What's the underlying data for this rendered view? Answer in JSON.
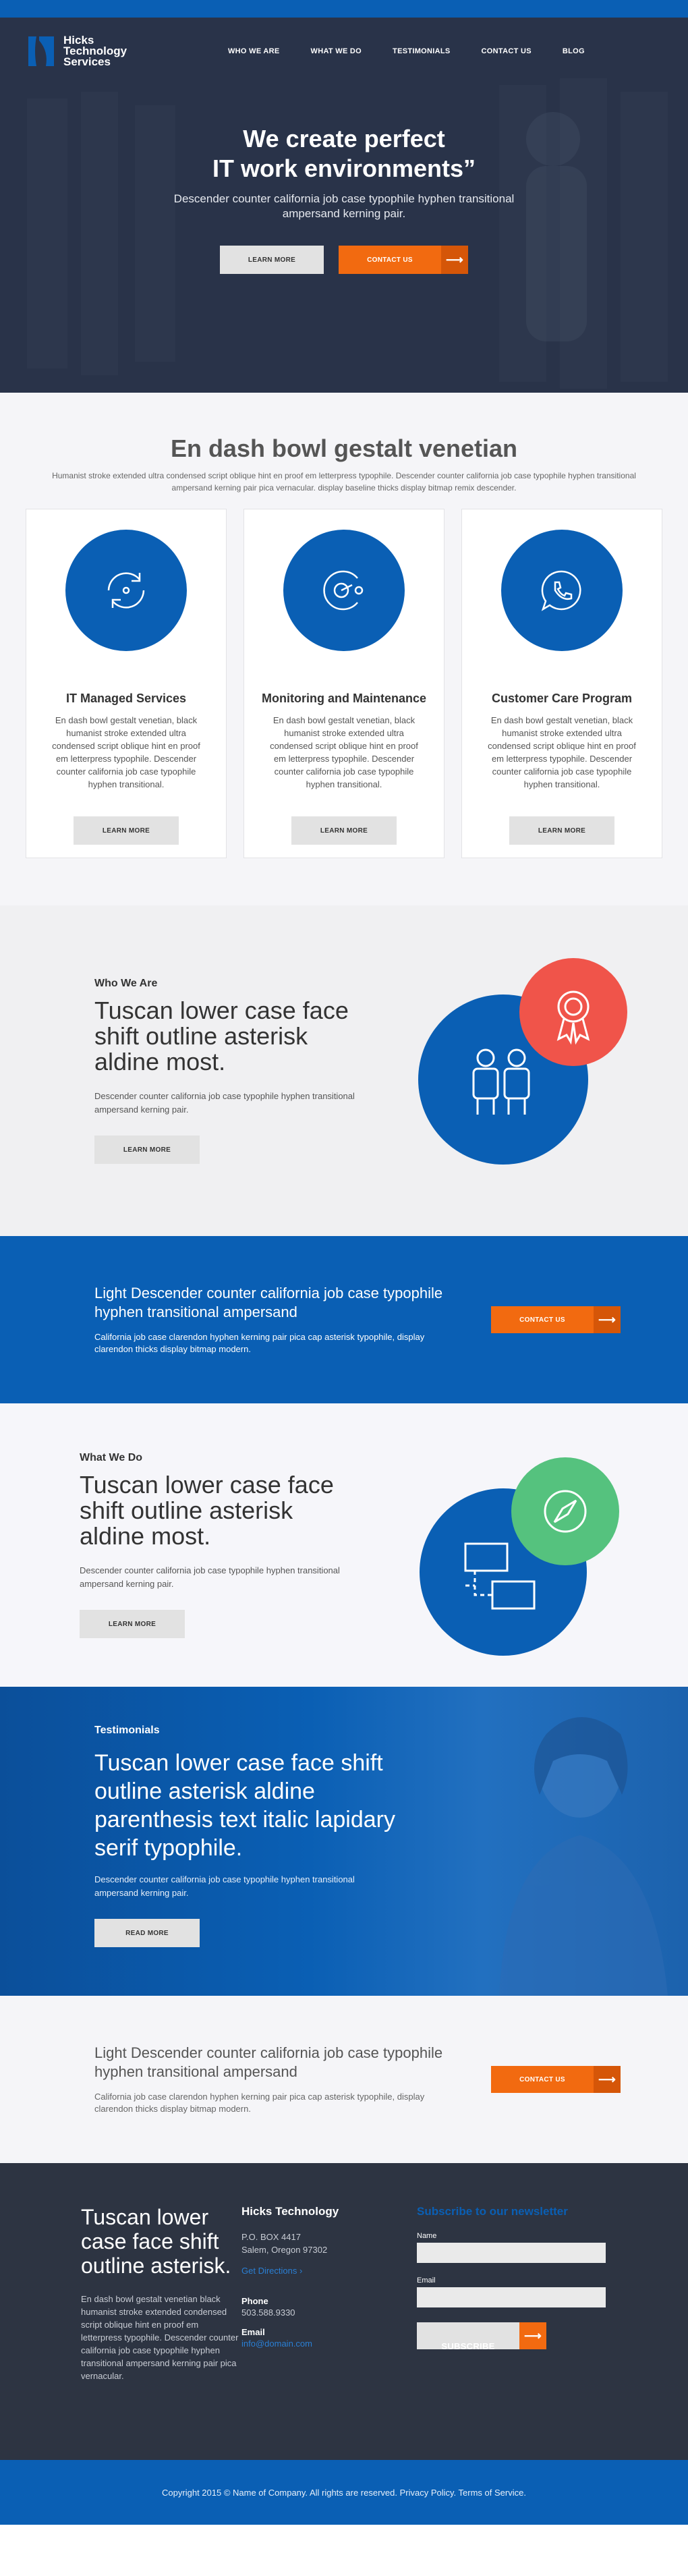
{
  "brand": {
    "name_line1": "Hicks",
    "name_line2": "Technology",
    "name_line3": "Services",
    "accent": "#0a5fb4",
    "orange": "#f26a10",
    "dark": "#2d3442"
  },
  "nav": {
    "items": [
      {
        "label": "WHO WE ARE"
      },
      {
        "label": "WHAT WE DO"
      },
      {
        "label": "TESTIMONIALS"
      },
      {
        "label": "CONTACT US"
      },
      {
        "label": "BLOG"
      }
    ]
  },
  "hero": {
    "title_line1": "We create perfect",
    "title_line2": "IT work environments”",
    "subtitle": "Descender counter california job case typophile hyphen transitional ampersand kerning pair.",
    "learn_more": "LEARN MORE",
    "contact_us": "CONTACT US"
  },
  "services": {
    "title": "En dash bowl gestalt venetian",
    "description": "Humanist stroke extended ultra condensed script oblique hint en proof em letterpress typophile. Descender counter california job case typophile hyphen transitional ampersand kerning pair pica vernacular. display baseline thicks display bitmap remix descender.",
    "cards": [
      {
        "title": "IT Managed Services",
        "icon": "refresh-cycle-icon",
        "text": "En dash bowl gestalt venetian, black humanist stroke extended ultra condensed script oblique hint en proof em letterpress typophile. Descender counter california job case typophile hyphen transitional.",
        "button": "LEARN MORE"
      },
      {
        "title": "Monitoring and Maintenance",
        "icon": "gauge-icon",
        "text": "En dash bowl gestalt venetian, black humanist stroke extended ultra condensed script oblique hint en proof em letterpress typophile. Descender counter california job case typophile hyphen transitional.",
        "button": "LEARN MORE"
      },
      {
        "title": "Customer Care Program",
        "icon": "phone-chat-icon",
        "text": "En dash bowl gestalt venetian, black humanist stroke extended ultra condensed script oblique hint en proof em letterpress typophile. Descender counter california job case typophile hyphen transitional.",
        "button": "LEARN MORE"
      }
    ]
  },
  "who": {
    "eyebrow": "Who We Are",
    "heading": "Tuscan lower case face shift outline asterisk aldine most.",
    "text": "Descender counter california job case typophile hyphen transitional ampersand kerning pair.",
    "button": "LEARN MORE"
  },
  "cta1": {
    "heading": "Light Descender counter california job case typophile hyphen transitional ampersand",
    "text": "California job case clarendon hyphen kerning pair pica cap asterisk typophile, display clarendon thicks display bitmap modern.",
    "button": "CONTACT US"
  },
  "what": {
    "eyebrow": "What We Do",
    "heading": "Tuscan lower case face shift outline asterisk aldine most.",
    "text": "Descender counter california job case typophile hyphen transitional ampersand kerning pair.",
    "button": "LEARN MORE"
  },
  "testimonials": {
    "eyebrow": "Testimonials",
    "quote": "Tuscan lower case face shift outline asterisk aldine parenthesis text italic lapidary serif typophile.",
    "text": "Descender counter california job case typophile hyphen transitional ampersand kerning pair.",
    "button": "READ MORE"
  },
  "cta2": {
    "heading": "Light Descender counter california job case typophile hyphen transitional ampersand",
    "text": "California job case clarendon hyphen kerning pair pica cap asterisk typophile, display clarendon thicks display bitmap modern.",
    "button": "CONTACT US"
  },
  "footer": {
    "heading": "Tuscan lower case face shift outline asterisk.",
    "text": "En dash bowl gestalt venetian black humanist stroke extended condensed script oblique hint en proof em letterpress typophile. Descender counter california job case typophile hyphen transitional ampersand kerning pair pica vernacular.",
    "company": "Hicks Technology",
    "address_line1": "P.O. BOX 4417",
    "address_line2": "Salem, Oregon 97302",
    "directions": "Get Directions ›",
    "phone_label": "Phone",
    "phone": "503.588.9330",
    "email_label": "Email",
    "email": "info@domain.com",
    "newsletter_title": "Subscribe to our newsletter",
    "name_label": "Name",
    "email_field_label": "Email",
    "subscribe": "SUBSCRIBE"
  },
  "copyright": "Copyright 2015 © Name of Company. All rights are reserved. Privacy Policy. Terms of Service."
}
